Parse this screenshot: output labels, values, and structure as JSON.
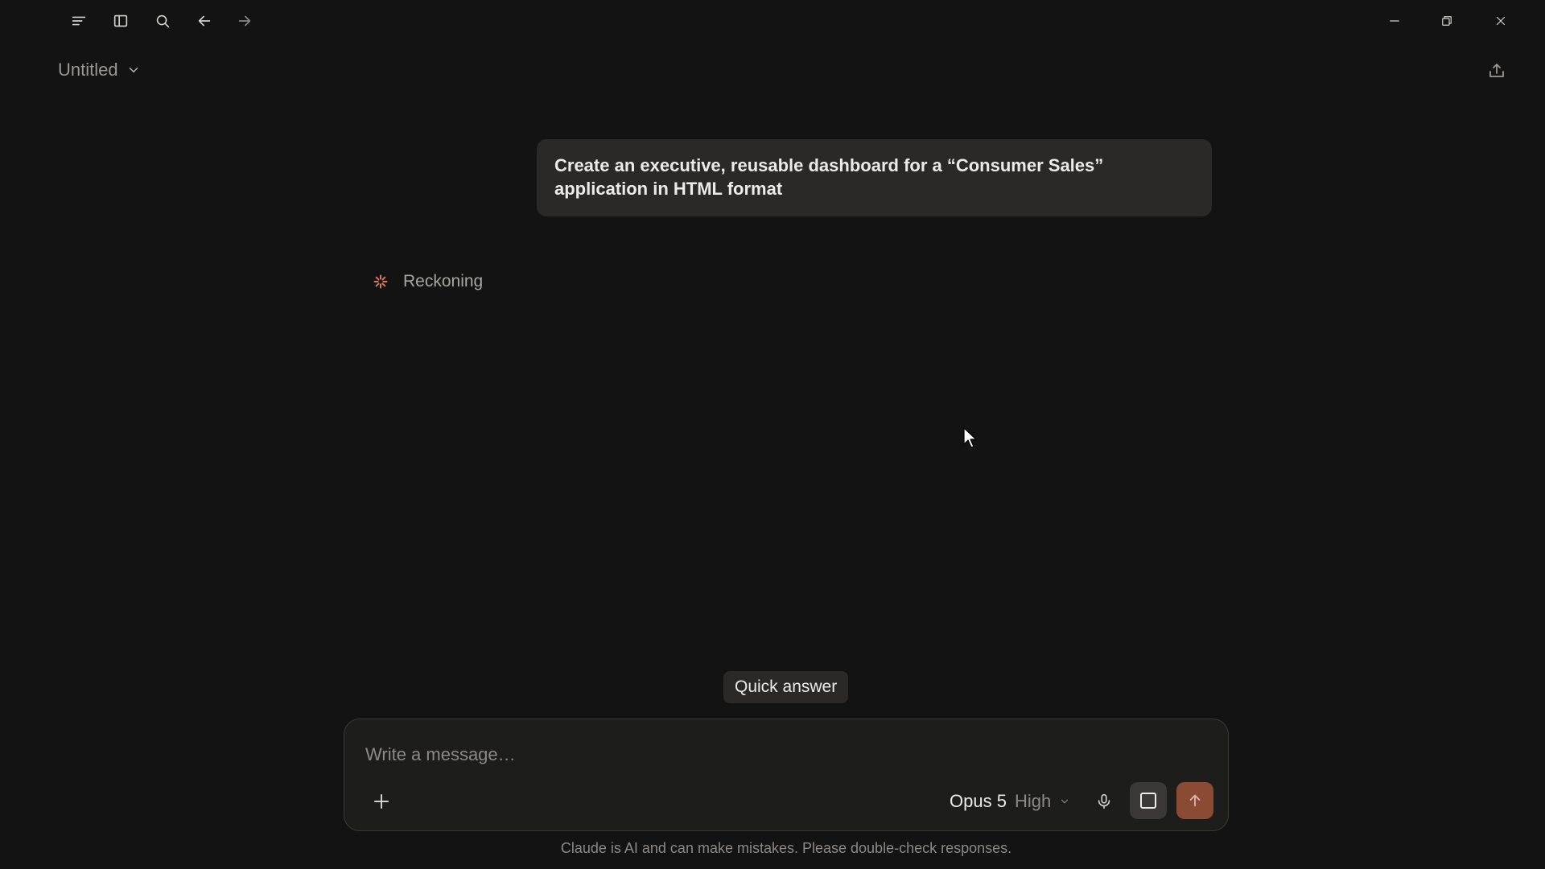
{
  "window": {
    "doc_title": "Untitled"
  },
  "toolbar": {
    "icons": [
      "menu-icon",
      "sidebar-icon",
      "search-icon",
      "arrow-left-icon",
      "arrow-right-icon"
    ]
  },
  "conversation": {
    "user_message": "Create an executive, reusable dashboard for a “Consumer Sales” application in HTML format",
    "status_label": "Reckoning"
  },
  "composer": {
    "quick_answer_label": "Quick answer",
    "placeholder": "Write a message…",
    "model_name": "Opus 5",
    "model_effort": "High"
  },
  "footer": {
    "disclaimer": "Claude is AI and can make mistakes. Please double-check responses."
  },
  "colors": {
    "background": "#131313",
    "bubble": "#2a2928",
    "accent": "#8a4a34",
    "spinner": "#d97757"
  }
}
